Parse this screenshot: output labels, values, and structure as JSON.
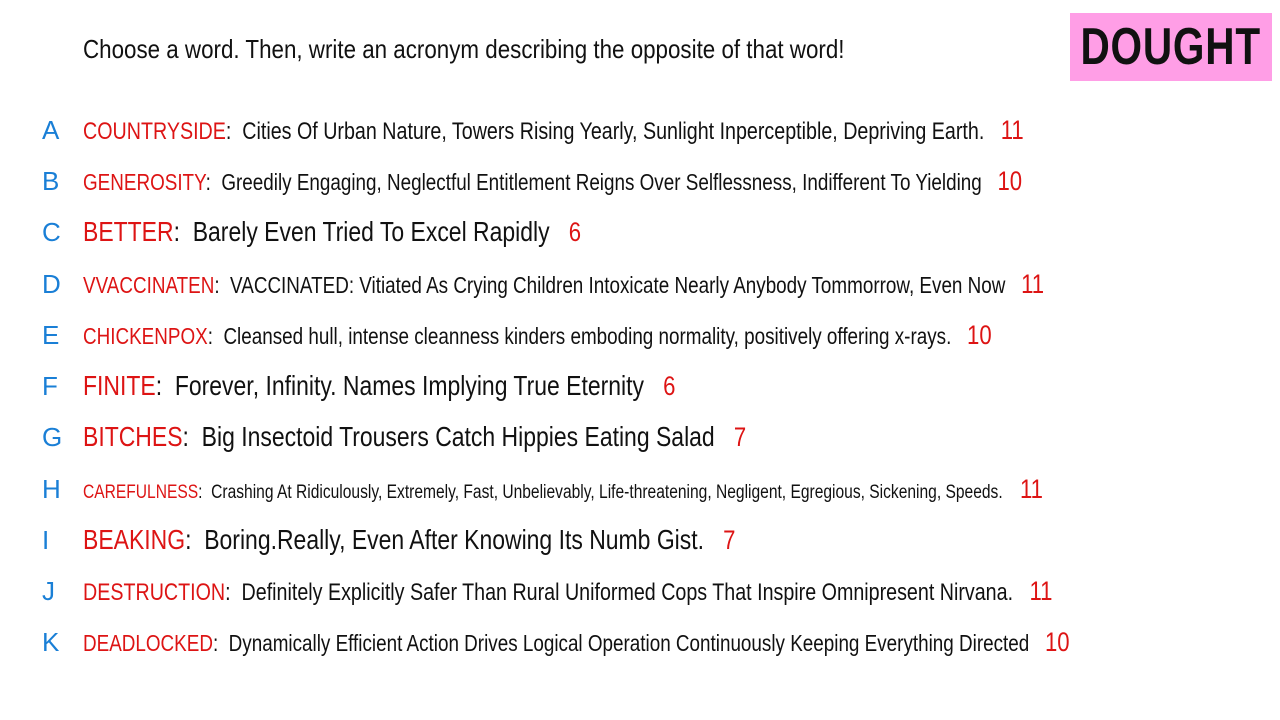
{
  "prompt": "Choose a word. Then, write an acronym describing the opposite of that word!",
  "badge": "DOUGHT",
  "entries": [
    {
      "letter": "A",
      "word": "COUNTRYSIDE",
      "definition": "Cities Of Urban Nature, Towers Rising Yearly, Sunlight Inperceptible, Depriving Earth.",
      "count": "11"
    },
    {
      "letter": "B",
      "word": "GENEROSITY",
      "definition": "Greedily Engaging, Neglectful Entitlement Reigns Over Selflessness, Indifferent To Yielding",
      "count": "10"
    },
    {
      "letter": "C",
      "word": "BETTER",
      "definition": "Barely Even Tried To Excel Rapidly",
      "count": "6"
    },
    {
      "letter": "D",
      "word": "VVACCINATEN",
      "definition": "VACCINATED: Vitiated As Crying Children Intoxicate Nearly Anybody Tommorrow, Even Now",
      "count": "11"
    },
    {
      "letter": "E",
      "word": "CHICKENPOX",
      "definition": "Cleansed hull, intense cleanness kinders emboding normality, positively offering x-rays.",
      "count": "10"
    },
    {
      "letter": "F",
      "word": "FINITE",
      "definition": "Forever, Infinity. Names Implying True Eternity",
      "count": "6"
    },
    {
      "letter": "G",
      "word": "BITCHES",
      "definition": "Big Insectoid Trousers Catch Hippies Eating Salad",
      "count": "7"
    },
    {
      "letter": "H",
      "word": "CAREFULNESS",
      "definition": "Crashing At Ridiculously, Extremely, Fast, Unbelievably, Life-threatening, Negligent, Egregious, Sickening, Speeds.",
      "count": "11"
    },
    {
      "letter": "I",
      "word": "BEAKING",
      "definition": "Boring.Really, Even After Knowing Its Numb Gist.",
      "count": "7"
    },
    {
      "letter": "J",
      "word": "DESTRUCTION",
      "definition": "Definitely Explicitly Safer Than Rural Uniformed Cops That Inspire Omnipresent Nirvana.",
      "count": "11"
    },
    {
      "letter": "K",
      "word": "DEADLOCKED",
      "definition": "Dynamically Efficient Action Drives Logical Operation Continuously Keeping Everything Directed",
      "count": "10"
    }
  ]
}
